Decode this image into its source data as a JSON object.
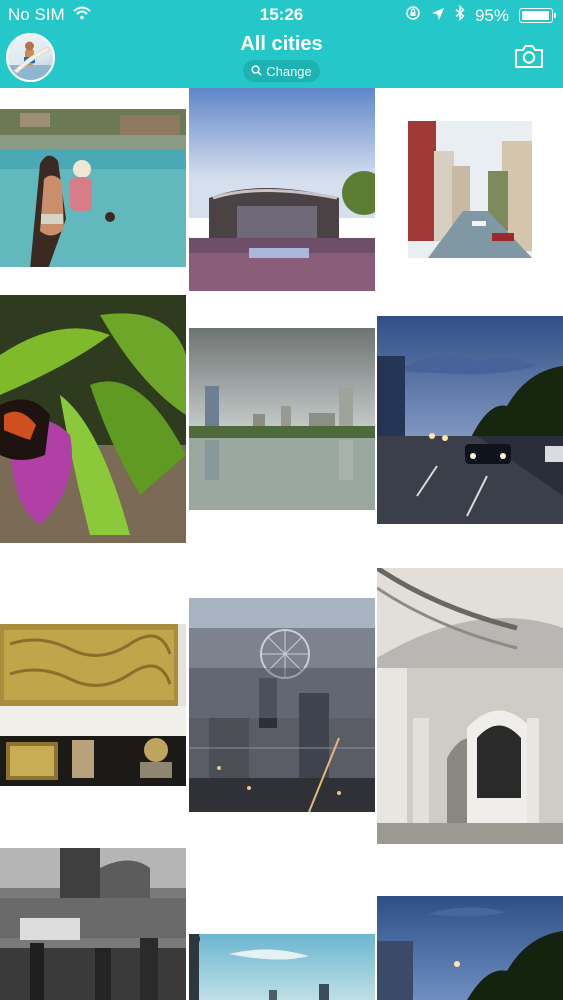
{
  "status_bar": {
    "carrier": "No SIM",
    "time": "15:26",
    "battery_percent": "95%",
    "battery_level": 0.95,
    "icons": [
      "wifi-icon",
      "rotation-lock-icon",
      "location-arrow-icon",
      "bluetooth-icon",
      "battery-icon"
    ]
  },
  "header": {
    "title": "All cities",
    "change_label": "Change",
    "icons": [
      "avatar",
      "search-icon",
      "camera-icon"
    ]
  },
  "colors": {
    "accent": "#25c8c8",
    "pill": "#1fb2b2",
    "background": "#ffffff"
  },
  "photos": [
    {
      "subject": "woman-and-baby-at-beach"
    },
    {
      "subject": "outdoor-arena-at-dusk"
    },
    {
      "subject": "venice-canal"
    },
    {
      "subject": "butterfly-on-purple-flower"
    },
    {
      "subject": "city-skyline-over-river"
    },
    {
      "subject": "road-at-night"
    },
    {
      "subject": "ornate-golden-box"
    },
    {
      "subject": "london-aerial-view"
    },
    {
      "subject": "ornate-hall-interior"
    },
    {
      "subject": "black-and-white-city-street"
    },
    {
      "subject": "city-skyline-blue-sky"
    },
    {
      "subject": "city-street-at-dusk"
    }
  ]
}
